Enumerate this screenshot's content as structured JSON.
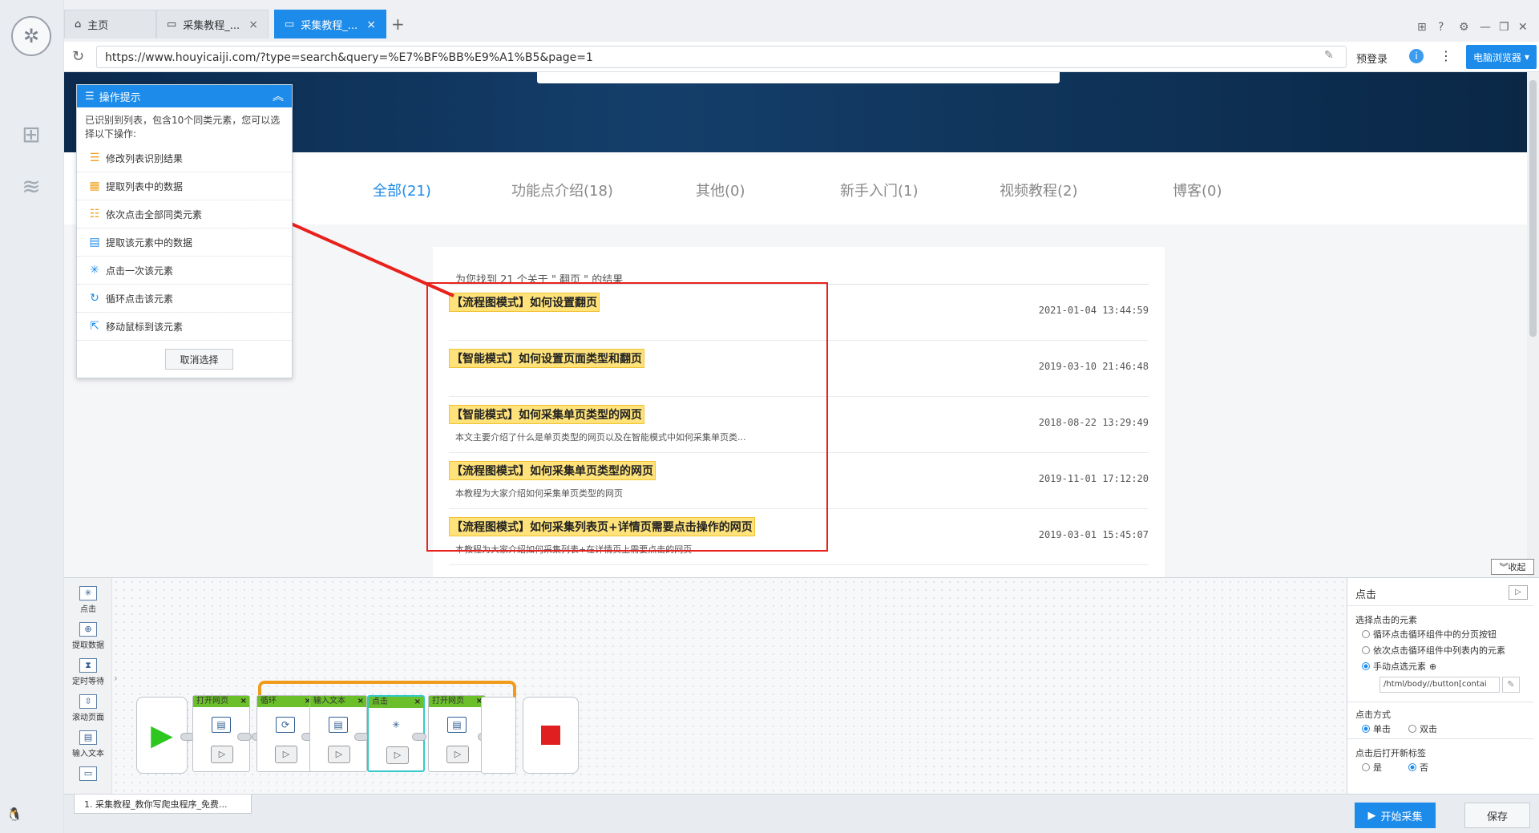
{
  "tabs": [
    {
      "label": "主页"
    },
    {
      "label": "采集教程_..."
    },
    {
      "label": "采集教程_..."
    }
  ],
  "address": {
    "url": "https://www.houyicaiji.com/?type=search&query=%E7%BF%BB%E9%A1%B5&page=1",
    "login": "预登录",
    "mode": "电脑浏览器"
  },
  "categories": [
    {
      "label": "全部(21)"
    },
    {
      "label": "功能点介绍(18)"
    },
    {
      "label": "其他(0)"
    },
    {
      "label": "新手入门(1)"
    },
    {
      "label": "视频教程(2)"
    },
    {
      "label": "博客(0)"
    }
  ],
  "results": {
    "header": "为您找到 21 个关于 \" 翻页 \" 的结果",
    "items": [
      {
        "title": "【流程图模式】如何设置翻页",
        "date": "2021-01-04 13:44:59",
        "desc": ""
      },
      {
        "title": "【智能模式】如何设置页面类型和翻页",
        "date": "2019-03-10 21:46:48",
        "desc": ""
      },
      {
        "title": "【智能模式】如何采集单页类型的网页",
        "date": "2018-08-22 13:29:49",
        "desc": "本文主要介绍了什么是单页类型的网页以及在智能模式中如何采集单页类..."
      },
      {
        "title": "【流程图模式】如何采集单页类型的网页",
        "date": "2019-11-01 17:12:20",
        "desc": "本教程为大家介绍如何采集单页类型的网页"
      },
      {
        "title": "【流程图模式】如何采集列表页+详情页需要点击操作的网页",
        "date": "2019-03-01 15:45:07",
        "desc": "本教程为大家介绍如何采集列表+在详情页上需要点击的网页"
      }
    ]
  },
  "hint": {
    "title": "操作提示",
    "desc": "已识别到列表，包含10个同类元素，您可以选择以下操作:",
    "items": [
      {
        "label": "修改列表识别结果"
      },
      {
        "label": "提取列表中的数据"
      },
      {
        "label": "依次点击全部同类元素"
      },
      {
        "label": "提取该元素中的数据"
      },
      {
        "label": "点击一次该元素"
      },
      {
        "label": "循环点击该元素"
      },
      {
        "label": "移动鼠标到该元素"
      }
    ],
    "cancel": "取消选择"
  },
  "collapse": "收起",
  "tools": [
    {
      "label": "点击"
    },
    {
      "label": "提取数据"
    },
    {
      "label": "定时等待"
    },
    {
      "label": "滚动页面"
    },
    {
      "label": "输入文本"
    }
  ],
  "steps": [
    {
      "label": "打开网页"
    },
    {
      "label": "循环"
    },
    {
      "label": "输入文本"
    },
    {
      "label": "点击"
    },
    {
      "label": "打开网页"
    }
  ],
  "props": {
    "title": "点击",
    "select_label": "选择点击的元素",
    "opt1": "循环点击循环组件中的分页按钮",
    "opt2": "依次点击循环组件中列表内的元素",
    "opt3": "手动点选元素",
    "xpath": "/html/body//button[contai",
    "click_mode_label": "点击方式",
    "single": "单击",
    "double": "双击",
    "newtab_label": "点击后打开新标签",
    "yes": "是",
    "no": "否"
  },
  "footer": {
    "task": "1. 采集教程_教你写爬虫程序_免费...",
    "start": "开始采集",
    "save": "保存"
  }
}
